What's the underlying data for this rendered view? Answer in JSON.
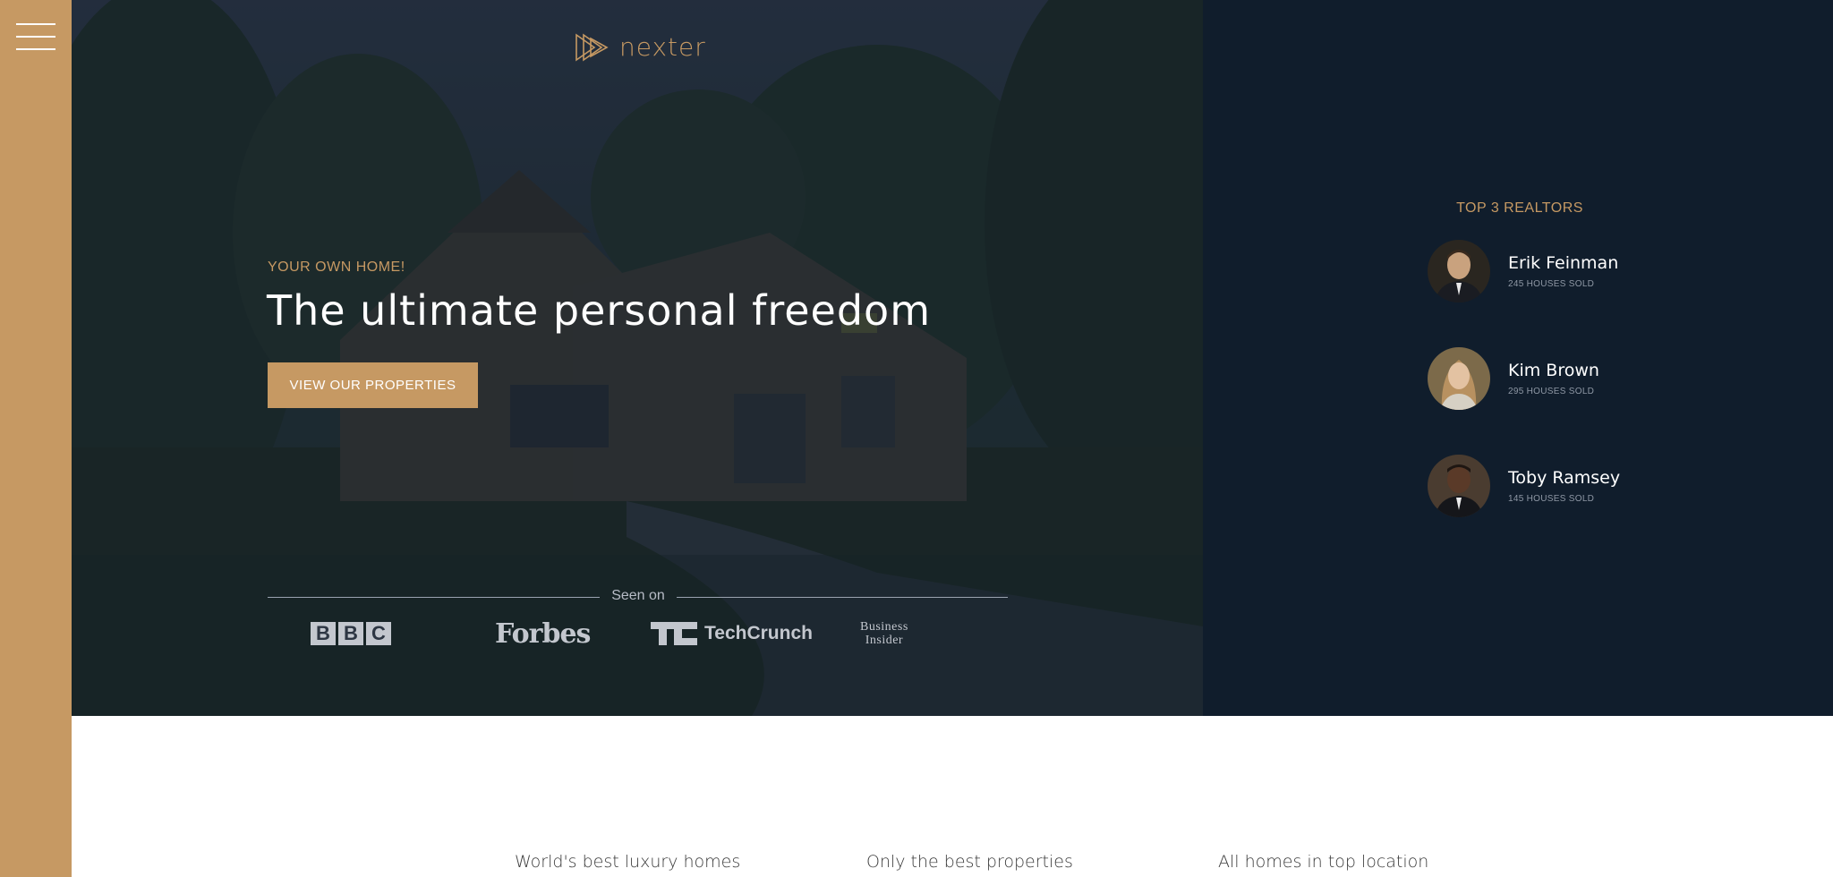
{
  "nav": {
    "menu_icon": "hamburger-menu-icon"
  },
  "brand": {
    "logo_icon": "play-triangle-logo-icon",
    "name": "nexter"
  },
  "hero": {
    "subtitle": "YOUR OWN HOME!",
    "title": "The ultimate personal freedom",
    "cta_label": "VIEW OUR PROPERTIES",
    "seen_on_label": "Seen on",
    "press": {
      "bbc": [
        "B",
        "B",
        "C"
      ],
      "forbes": "Forbes",
      "techcrunch": "TechCrunch",
      "business_insider_line1": "Business",
      "business_insider_line2": "Insider"
    }
  },
  "realtors": {
    "title": "TOP 3 REALTORS",
    "items": [
      {
        "name": "Erik Feinman",
        "sold": "245 HOUSES SOLD"
      },
      {
        "name": "Kim Brown",
        "sold": "295 HOUSES SOLD"
      },
      {
        "name": "Toby Ramsey",
        "sold": "145 HOUSES SOLD"
      }
    ]
  },
  "features": {
    "items": [
      {
        "title": "World's best luxury homes"
      },
      {
        "title": "Only the best properties"
      },
      {
        "title": "All homes in top location"
      }
    ]
  },
  "colors": {
    "primary_gold": "#c69963",
    "dark_navy": "#101d2c",
    "white": "#ffffff"
  }
}
